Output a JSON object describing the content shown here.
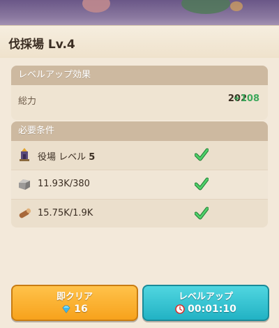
{
  "header": {
    "title": "伐採場  Lv.4"
  },
  "effect": {
    "heading": "レベルアップ効果",
    "stat": {
      "label": "総力",
      "base": "202",
      "bonus": "+108"
    }
  },
  "requirements": {
    "heading": "必要条件",
    "items": [
      {
        "icon": "town-hall-icon",
        "name": "役場  レベル",
        "level": "5",
        "met": true
      },
      {
        "icon": "stone-icon",
        "amount": "11.93K/380",
        "met": true
      },
      {
        "icon": "wood-log-icon",
        "amount": "15.75K/1.9K",
        "met": true
      }
    ]
  },
  "buttons": {
    "instant_clear": {
      "label": "即クリア",
      "cost": "16",
      "icon": "gem-icon"
    },
    "level_up": {
      "label": "レベルアップ",
      "time": "00:01:10",
      "icon": "clock-icon"
    }
  },
  "colors": {
    "bonus": "#3da85b",
    "check": "#2fa84a",
    "clear_button": "#f7a21c",
    "levelup_button": "#22b2c4"
  }
}
